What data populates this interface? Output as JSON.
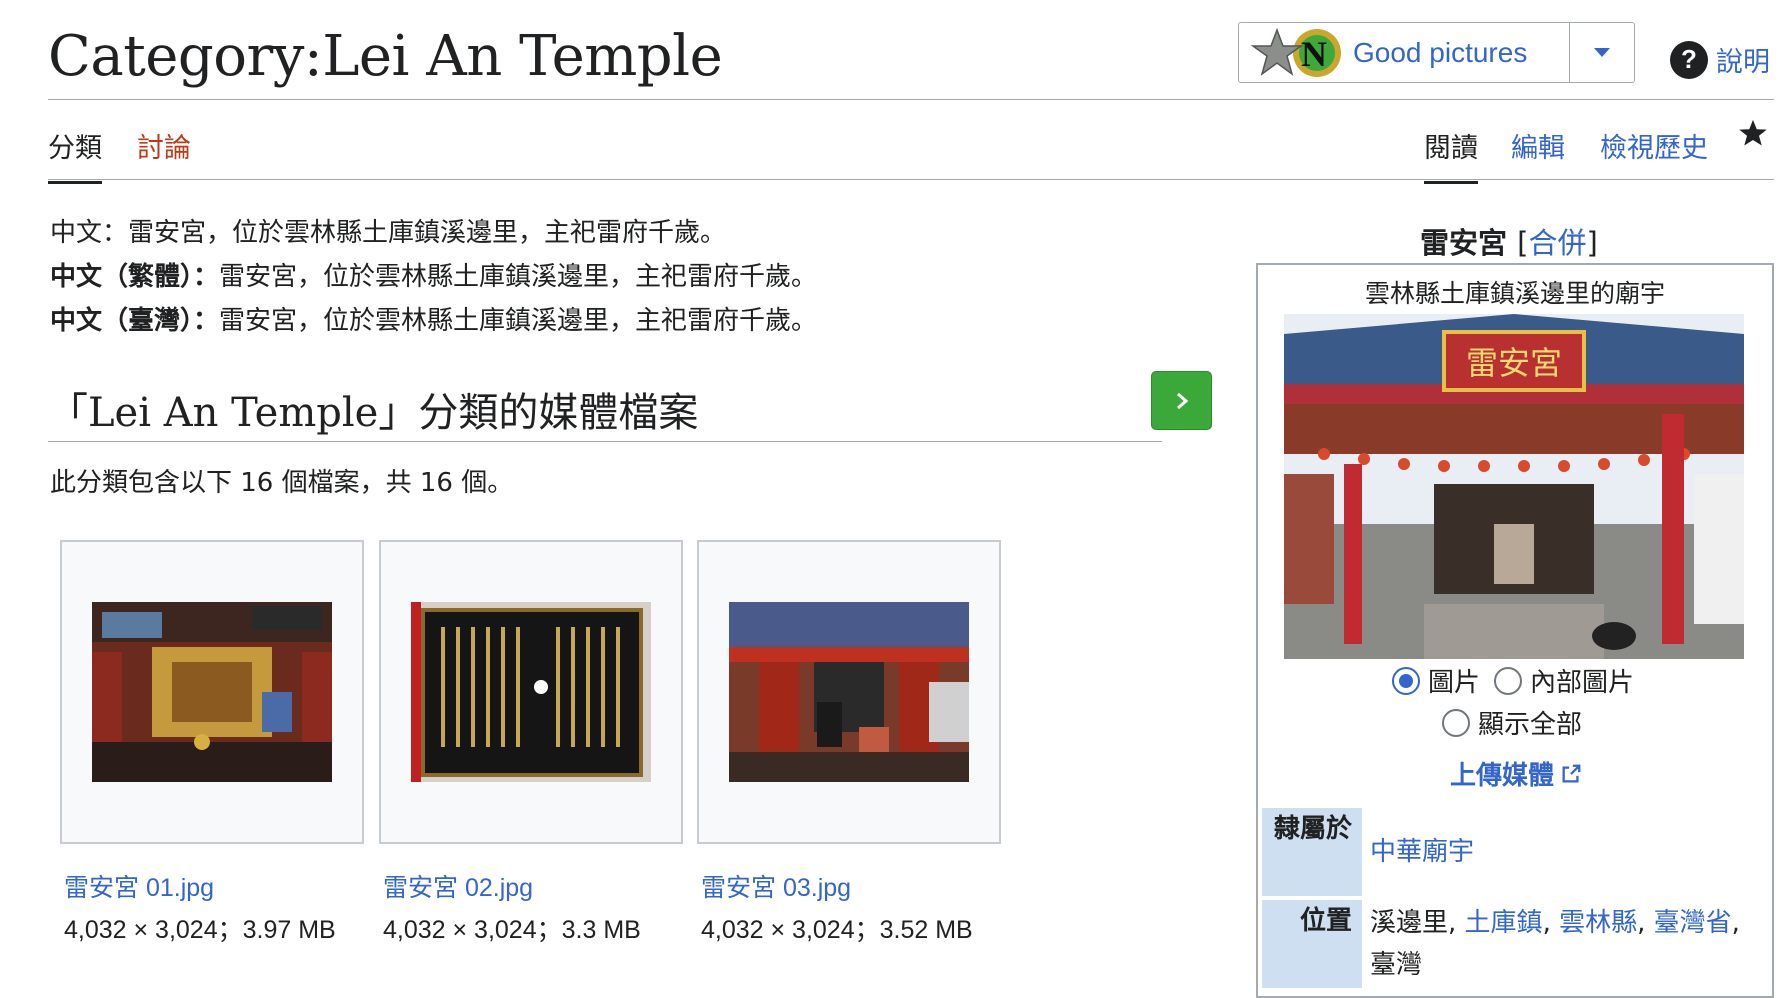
{
  "header": {
    "title": "Category:Lei An Temple",
    "good_pictures": "Good pictures",
    "help": "說明"
  },
  "tabs": {
    "category": "分類",
    "talk": "討論",
    "read": "閱讀",
    "edit": "編輯",
    "history": "檢視歷史"
  },
  "descriptions": [
    {
      "label": "中文：",
      "text": "雷安宮，位於雲林縣土庫鎮溪邊里，主祀雷府千歲。"
    },
    {
      "label": "中文（繁體）：",
      "text": "雷安宮，位於雲林縣土庫鎮溪邊里，主祀雷府千歲。"
    },
    {
      "label": "中文（臺灣）：",
      "text": "雷安宮，位於雲林縣土庫鎮溪邊里，主祀雷府千歲。"
    }
  ],
  "media": {
    "heading": "「Lei An Temple」分類的媒體檔案",
    "count_text": "此分類包含以下 16 個檔案，共 16 個。",
    "files": [
      {
        "name": "雷安宮 01.jpg",
        "meta": "4,032 × 3,024；3.97 MB"
      },
      {
        "name": "雷安宮 02.jpg",
        "meta": "4,032 × 3,024；3.3 MB"
      },
      {
        "name": "雷安宮 03.jpg",
        "meta": "4,032 × 3,024；3.52 MB"
      }
    ]
  },
  "infobox": {
    "title": "雷安宮",
    "merge": "合併",
    "caption": "雲林縣土庫鎮溪邊里的廟宇",
    "sign_text": "雷安宮",
    "radio_picture": "圖片",
    "radio_interior": "內部圖片",
    "radio_all": "顯示全部",
    "upload": "上傳媒體",
    "affiliation_label": "隸屬於",
    "affiliation_value": "中華廟宇",
    "location_label": "位置",
    "location": {
      "village": "溪邊里",
      "town": "土庫鎮",
      "county": "雲林縣",
      "province": "臺灣省",
      "country": "臺灣"
    }
  },
  "colors": {
    "link": "#3366cc",
    "talk": "#ba3a1a",
    "next_button": "#3ba83a",
    "label_bg": "#cedff2"
  }
}
